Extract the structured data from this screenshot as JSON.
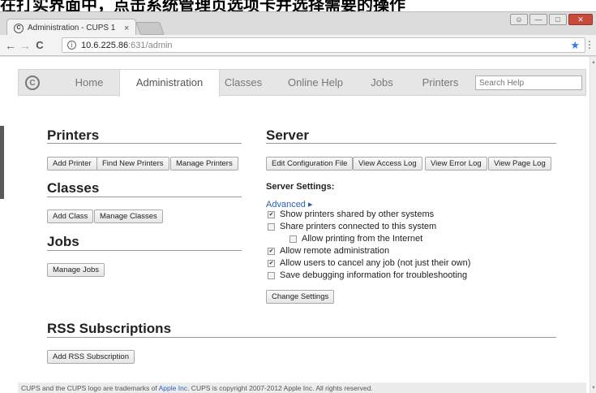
{
  "caption": {
    "text": "在打实界面中，点击系统管理页选项卡并选择需要的操作"
  },
  "browser": {
    "tab_title": "Administration - CUPS 1",
    "tab_close": "×",
    "url_host": "10.6.225.86",
    "url_rest": ":631/admin",
    "back": "←",
    "forward": "→",
    "reload": "C",
    "star": "★",
    "kebab": "⋮"
  },
  "nav": {
    "items": [
      "Home",
      "Administration",
      "Classes",
      "Online Help",
      "Jobs",
      "Printers"
    ],
    "active": "Administration",
    "search_placeholder": "Search Help"
  },
  "printers": {
    "title": "Printers",
    "buttons": [
      "Add Printer",
      "Find New Printers",
      "Manage Printers"
    ]
  },
  "classes": {
    "title": "Classes",
    "buttons": [
      "Add Class",
      "Manage Classes"
    ]
  },
  "jobs": {
    "title": "Jobs",
    "buttons": [
      "Manage Jobs"
    ]
  },
  "server": {
    "title": "Server",
    "buttons": [
      "Edit Configuration File",
      "View Access Log",
      "View Error Log",
      "View Page Log"
    ],
    "settings_label": "Server Settings:",
    "advanced": "Advanced ▸",
    "options": [
      {
        "label": "Show printers shared by other systems",
        "checked": true
      },
      {
        "label": "Share printers connected to this system",
        "checked": false
      },
      {
        "label": "Allow printing from the Internet",
        "checked": false
      },
      {
        "label": "Allow remote administration",
        "checked": true
      },
      {
        "label": "Allow users to cancel any job (not just their own)",
        "checked": true
      },
      {
        "label": "Save debugging information for troubleshooting",
        "checked": false
      }
    ],
    "change_button": "Change Settings"
  },
  "rss": {
    "title": "RSS Subscriptions",
    "button": "Add RSS Subscription"
  },
  "footer": {
    "part1": "CUPS and the CUPS logo are trademarks of ",
    "link": "Apple Inc",
    "part2": ". CUPS is copyright 2007-2012 Apple Inc. All rights reserved."
  },
  "colors": {
    "link": "#2a5fb5",
    "star": "#3b7be8",
    "close_button": "#c84a3c"
  }
}
